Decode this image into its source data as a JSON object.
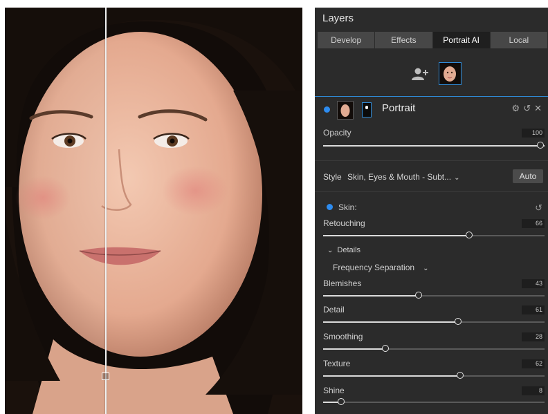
{
  "panel": {
    "title": "Layers",
    "tabs": [
      {
        "label": "Develop",
        "active": false
      },
      {
        "label": "Effects",
        "active": false
      },
      {
        "label": "Portrait AI",
        "active": true
      },
      {
        "label": "Local",
        "active": false
      }
    ],
    "layer": {
      "name": "Portrait",
      "icons": [
        "gear-icon",
        "undo-icon",
        "close-icon"
      ]
    },
    "opacity": {
      "label": "Opacity",
      "value": "100",
      "level": 100
    },
    "style": {
      "prefix": "Style",
      "value": "Skin, Eyes & Mouth - Subt...",
      "auto_label": "Auto"
    },
    "skin": {
      "label": "Skin:"
    },
    "retouching": {
      "label": "Retouching",
      "value": "66",
      "level": 66
    },
    "details": {
      "label": "Details",
      "method": "Frequency Separation"
    },
    "sliders": [
      {
        "label": "Blemishes",
        "value": "43",
        "level": 43
      },
      {
        "label": "Detail",
        "value": "61",
        "level": 61
      },
      {
        "label": "Smoothing",
        "value": "28",
        "level": 28
      },
      {
        "label": "Texture",
        "value": "62",
        "level": 62
      },
      {
        "label": "Shine",
        "value": "8",
        "level": 8
      }
    ]
  },
  "colors": {
    "accent": "#2f8bd8",
    "panel_bg": "#2b2b2b",
    "dot": "#2d8cf0"
  }
}
